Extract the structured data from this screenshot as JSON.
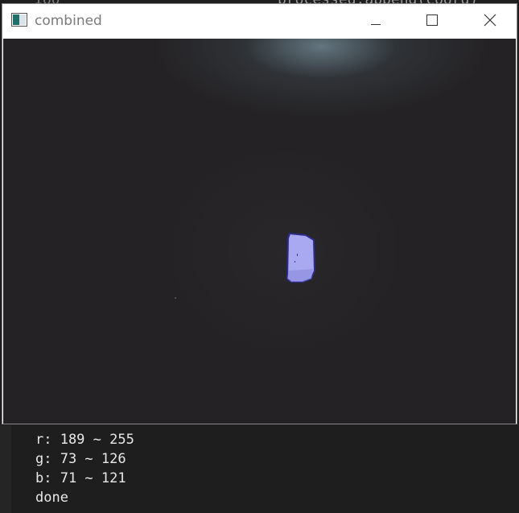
{
  "window": {
    "title": "combined"
  },
  "icons": {
    "app": "window-app-icon",
    "minimize": "minimize-icon",
    "maximize": "maximize-icon",
    "close": "close-icon"
  },
  "colors": {
    "canvas_background": "#242224",
    "blob_fill": "#a9a9f2",
    "blob_outline": "#2b2b8c",
    "console_text": "#e8e8e8"
  },
  "console": {
    "lines": [
      "r: 189 ~ 255",
      "g: 73 ~ 126",
      "b: 71 ~ 121",
      "done"
    ]
  }
}
